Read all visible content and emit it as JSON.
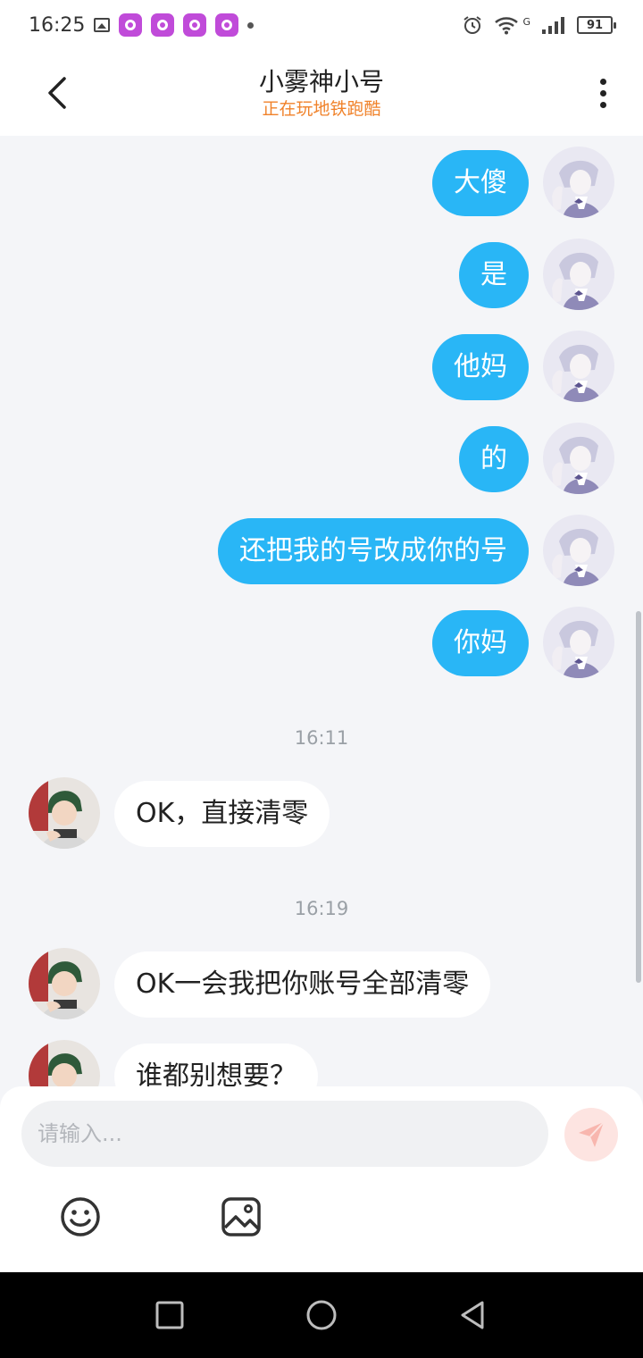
{
  "status_bar": {
    "time": "16:25",
    "network_label": "G",
    "battery": "91"
  },
  "header": {
    "title": "小雾神小号",
    "subtitle": "正在玩地铁跑酷",
    "subtitle_color": "#f0822a"
  },
  "colors": {
    "self_bubble": "#29b6f6",
    "other_bubble": "#ffffff",
    "background": "#f4f5f8"
  },
  "messages": [
    {
      "side": "self",
      "text": "大傻"
    },
    {
      "side": "self",
      "text": "是"
    },
    {
      "side": "self",
      "text": "他妈"
    },
    {
      "side": "self",
      "text": "的"
    },
    {
      "side": "self",
      "text": "还把我的号改成你的号"
    },
    {
      "side": "self",
      "text": "你妈"
    },
    {
      "type": "time",
      "text": "16:11"
    },
    {
      "side": "other",
      "text": "OK，直接清零"
    },
    {
      "type": "time",
      "text": "16:19"
    },
    {
      "side": "other",
      "text": "OK一会我把你账号全部清零"
    },
    {
      "side": "other",
      "text": "谁都别想要？"
    }
  ],
  "input": {
    "placeholder": "请输入..."
  },
  "icons": {
    "back": "chevron-left-icon",
    "more": "more-vertical-icon",
    "send": "send-icon",
    "emoji": "emoji-icon",
    "image": "image-icon",
    "recent": "square-icon",
    "home": "circle-icon",
    "nav_back": "triangle-back-icon"
  }
}
